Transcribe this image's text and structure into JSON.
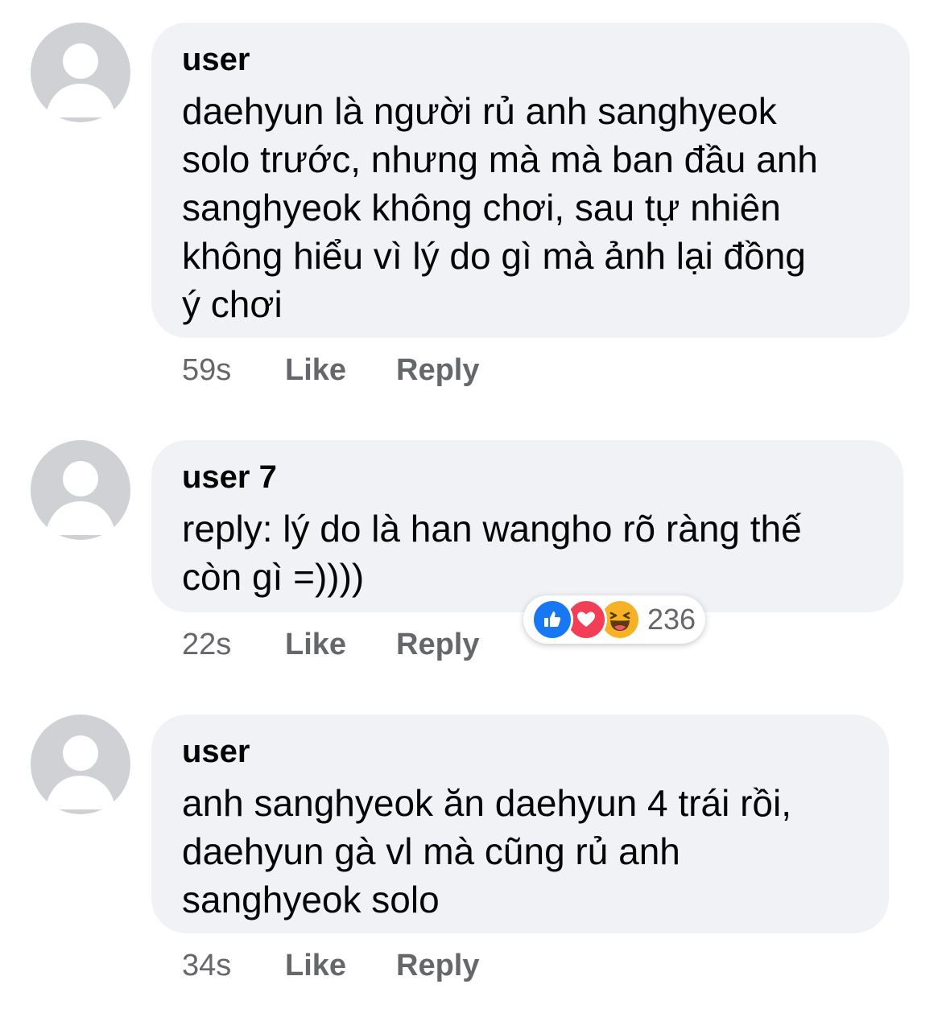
{
  "comments": [
    {
      "author": "user",
      "text": "daehyun là người rủ anh sanghyeok\nsolo trước, nhưng mà mà ban đầu anh\nsanghyeok không chơi, sau tự nhiên\nkhông hiểu vì lý do gì mà ảnh lại đồng\ný chơi",
      "time": "59s",
      "like": "Like",
      "reply": "Reply"
    },
    {
      "author": "user 7",
      "text": "reply: lý do là han wangho rõ ràng thế\ncòn gì =))))",
      "time": "22s",
      "like": "Like",
      "reply": "Reply",
      "reactions": {
        "icons": [
          "like-icon",
          "love-icon",
          "haha-icon"
        ],
        "count": "236"
      }
    },
    {
      "author": "user",
      "text": "anh sanghyeok ăn daehyun 4 trái rồi,\ndaehyun gà vl mà cũng rủ anh\nsanghyeok solo",
      "time": "34s",
      "like": "Like",
      "reply": "Reply"
    }
  ],
  "colors": {
    "bubble": "#f0f2f5",
    "avatar": "#cfd1d4",
    "meta_text": "#65676b",
    "like_blue": "#1877f2",
    "love_red": "#f33e58",
    "haha_yellow": "#f7b125"
  }
}
